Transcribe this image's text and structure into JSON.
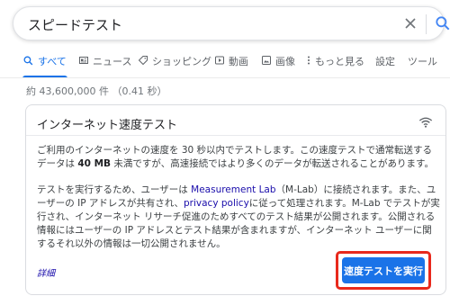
{
  "search": {
    "query": "スピードテスト"
  },
  "tabs": [
    {
      "label": "すべて",
      "icon": "search-icon",
      "active": true
    },
    {
      "label": "ニュース",
      "icon": "news-icon"
    },
    {
      "label": "ショッピング",
      "icon": "tag-icon"
    },
    {
      "label": "動画",
      "icon": "play-icon"
    },
    {
      "label": "画像",
      "icon": "image-icon"
    },
    {
      "label": "もっと見る",
      "icon": "more-vert-icon"
    },
    {
      "label": "設定"
    },
    {
      "label": "ツール"
    }
  ],
  "result_stats": "約 43,600,000 件 （0.41 秒）",
  "card": {
    "title": "インターネット速度テスト",
    "p1_a": "ご利用のインターネットの速度を 30 秒以内でテストします。この速度テストで通常転送するデータは ",
    "p1_bold": "40 MB",
    "p1_b": " 未満ですが、高速接続ではより多くのデータが転送されることがあります。",
    "p2_a": "テストを実行するため、ユーザーは ",
    "p2_link1": "Measurement Lab",
    "p2_b": "（M-Lab）に接続されます。また、ユーザーの IP アドレスが共有され、",
    "p2_link2": "privacy policy",
    "p2_c": "に従って処理されます。M-Lab でテストが実行され、インターネット リサーチ促進のためすべてのテスト結果が公開されます。公開される情報にはユーザーの IP アドレスとテスト結果が含まれますが、インターネット ユーザーに関するそれ以外の情報は一切公開されません。",
    "details_link": "詳細",
    "run_button": "速度テストを実行"
  },
  "colors": {
    "accent": "#1a73e8",
    "highlight_outline": "#e8291c",
    "link": "#1a0dab"
  }
}
